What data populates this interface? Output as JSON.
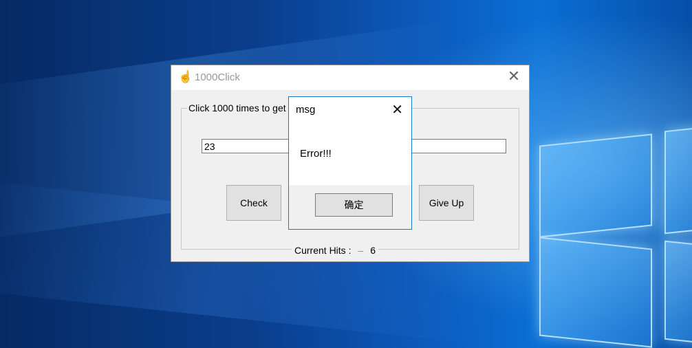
{
  "window": {
    "title": "1000Click",
    "icon": "hand-pointer-icon",
    "group_label": "Click 1000 times to get",
    "input_value": "23",
    "check_label": "Check",
    "give_up_label": "Give Up",
    "hits_label": "Current Hits :",
    "hits_separator": "–",
    "hits_value": "6"
  },
  "dialog": {
    "title": "msg",
    "message": "Error!!!",
    "ok_label": "确定"
  },
  "colors": {
    "dialog_border": "#1979ca",
    "window_bg": "#f0f0f0",
    "desktop_accent": "#0c5bbd"
  }
}
